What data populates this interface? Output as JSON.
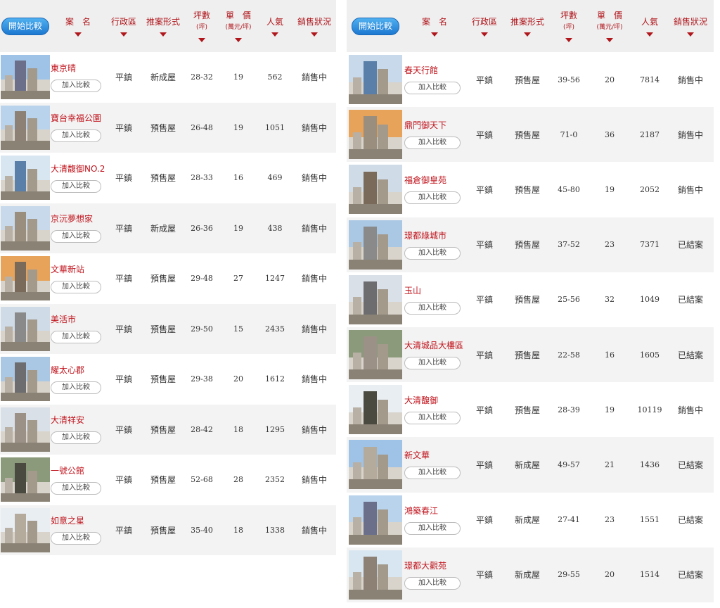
{
  "header": {
    "compare_button": "開始比較",
    "columns": {
      "name": "案　名",
      "district": "行政區",
      "type": "推案形式",
      "size": "坪數",
      "size_unit": "(坪)",
      "price": "單　價",
      "price_unit": "(萬元/坪)",
      "popularity": "人氣",
      "status": "銷售狀況"
    }
  },
  "add_label": "加入比較",
  "colors": {
    "accent": "#c0141d",
    "button_blue": "#1d78d0",
    "row_alt": "#f3f3f3"
  },
  "left": [
    {
      "name": "東京晴",
      "district": "平鎮",
      "type": "新成屋",
      "size": "28-32",
      "price": "19",
      "pop": "562",
      "status": "銷售中"
    },
    {
      "name": "寶台幸福公園",
      "district": "平鎮",
      "type": "預售屋",
      "size": "26-48",
      "price": "19",
      "pop": "1051",
      "status": "銷售中"
    },
    {
      "name": "大清馥御NO.2",
      "district": "平鎮",
      "type": "預售屋",
      "size": "28-33",
      "price": "16",
      "pop": "469",
      "status": "銷售中"
    },
    {
      "name": "京沅夢想家",
      "district": "平鎮",
      "type": "新成屋",
      "size": "26-36",
      "price": "19",
      "pop": "438",
      "status": "銷售中"
    },
    {
      "name": "文華新站",
      "district": "平鎮",
      "type": "預售屋",
      "size": "29-48",
      "price": "27",
      "pop": "1247",
      "status": "銷售中"
    },
    {
      "name": "美活市",
      "district": "平鎮",
      "type": "預售屋",
      "size": "29-50",
      "price": "15",
      "pop": "2435",
      "status": "銷售中"
    },
    {
      "name": "耀太心郡",
      "district": "平鎮",
      "type": "預售屋",
      "size": "29-38",
      "price": "20",
      "pop": "1612",
      "status": "銷售中"
    },
    {
      "name": "大清祥安",
      "district": "平鎮",
      "type": "預售屋",
      "size": "28-42",
      "price": "18",
      "pop": "1295",
      "status": "銷售中"
    },
    {
      "name": "一號公館",
      "district": "平鎮",
      "type": "預售屋",
      "size": "52-68",
      "price": "28",
      "pop": "2352",
      "status": "銷售中"
    },
    {
      "name": "如意之星",
      "district": "平鎮",
      "type": "預售屋",
      "size": "35-40",
      "price": "18",
      "pop": "1338",
      "status": "銷售中"
    }
  ],
  "right": [
    {
      "name": "春天行館",
      "district": "平鎮",
      "type": "預售屋",
      "size": "39-56",
      "price": "20",
      "pop": "7814",
      "status": "銷售中"
    },
    {
      "name": "鼎門御天下",
      "district": "平鎮",
      "type": "預售屋",
      "size": "71-0",
      "price": "36",
      "pop": "2187",
      "status": "銷售中"
    },
    {
      "name": "福倉御皇苑",
      "district": "平鎮",
      "type": "預售屋",
      "size": "45-80",
      "price": "19",
      "pop": "2052",
      "status": "銷售中"
    },
    {
      "name": "璟都綠城市",
      "district": "平鎮",
      "type": "預售屋",
      "size": "37-52",
      "price": "23",
      "pop": "7371",
      "status": "已結案"
    },
    {
      "name": "玉山",
      "district": "平鎮",
      "type": "預售屋",
      "size": "25-56",
      "price": "32",
      "pop": "1049",
      "status": "已結案"
    },
    {
      "name": "大清城品大樓區",
      "district": "平鎮",
      "type": "預售屋",
      "size": "22-58",
      "price": "16",
      "pop": "1605",
      "status": "已結案"
    },
    {
      "name": "大清馥御",
      "district": "平鎮",
      "type": "預售屋",
      "size": "28-39",
      "price": "19",
      "pop": "10119",
      "status": "銷售中"
    },
    {
      "name": "新文華",
      "district": "平鎮",
      "type": "新成屋",
      "size": "49-57",
      "price": "21",
      "pop": "1436",
      "status": "已結案"
    },
    {
      "name": "鴻築春江",
      "district": "平鎮",
      "type": "新成屋",
      "size": "27-41",
      "price": "23",
      "pop": "1551",
      "status": "已結案"
    },
    {
      "name": "璟都大觀苑",
      "district": "平鎮",
      "type": "新成屋",
      "size": "29-55",
      "price": "20",
      "pop": "1514",
      "status": "已結案"
    }
  ]
}
